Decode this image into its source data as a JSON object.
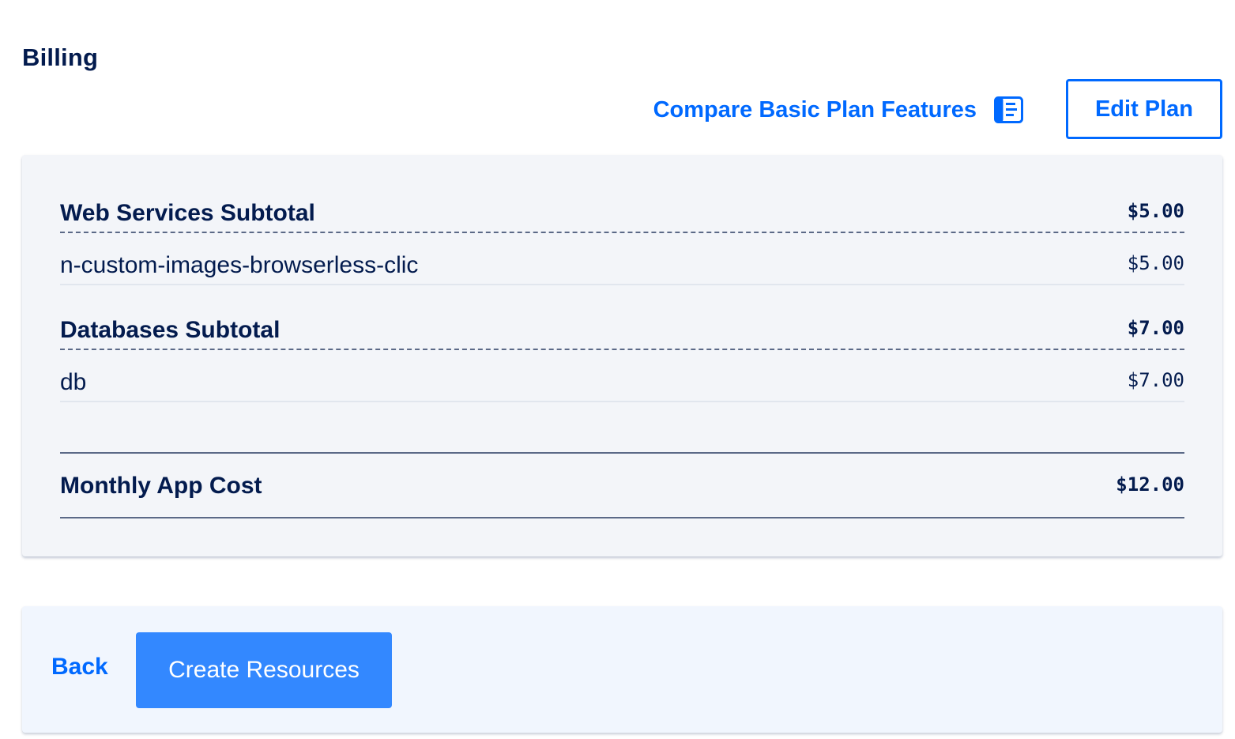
{
  "page": {
    "title": "Billing"
  },
  "header_actions": {
    "compare_link_label": "Compare Basic Plan Features",
    "compare_icon": "document-list-icon",
    "edit_plan_label": "Edit Plan"
  },
  "billing": {
    "sections": [
      {
        "subtotal_label": "Web Services Subtotal",
        "subtotal_amount": "$5.00",
        "items": [
          {
            "name": "n-custom-images-browserless-clic",
            "amount": "$5.00"
          }
        ]
      },
      {
        "subtotal_label": "Databases Subtotal",
        "subtotal_amount": "$7.00",
        "items": [
          {
            "name": "db",
            "amount": "$7.00"
          }
        ]
      }
    ],
    "total_label": "Monthly App Cost",
    "total_amount": "$12.00"
  },
  "footer": {
    "back_label": "Back",
    "create_label": "Create Resources"
  },
  "colors": {
    "accent": "#0069ff",
    "primary_button": "#3388ff",
    "text_dark": "#031b4e",
    "card_bg": "#f3f5f9",
    "footer_bg": "#f1f6fe"
  }
}
